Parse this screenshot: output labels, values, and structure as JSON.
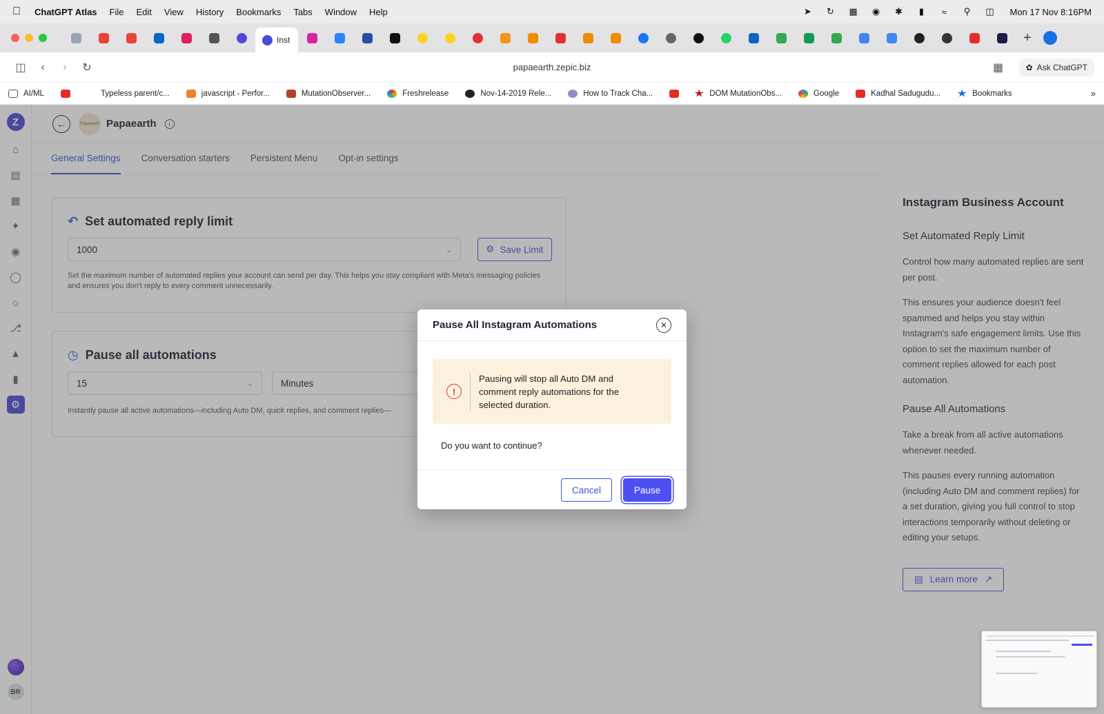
{
  "menubar": {
    "app_name": "ChatGPT Atlas",
    "menus": [
      "File",
      "Edit",
      "View",
      "History",
      "Bookmarks",
      "Tabs",
      "Window",
      "Help"
    ],
    "clock": "Mon 17 Nov  8:16PM"
  },
  "browser": {
    "active_tab_label": "Inst",
    "url": "papaearth.zepic.biz",
    "ask_button": "Ask ChatGPT",
    "bookmarks": [
      {
        "label": "AI/ML",
        "color": "#555555"
      },
      {
        "label": "",
        "color": "#e52d27"
      },
      {
        "label": "Typeless parent/c...",
        "color": "#ffffff"
      },
      {
        "label": "javascript - Perfor...",
        "color": "#f48024"
      },
      {
        "label": "MutationObserver...",
        "color": "#b5412e"
      },
      {
        "label": "Freshrelease",
        "color": "#3fa7e8"
      },
      {
        "label": "Nov-14-2019 Rele...",
        "color": "#222222"
      },
      {
        "label": "How to Track Cha...",
        "color": "#8f8fc8"
      },
      {
        "label": "",
        "color": "#e52d27"
      },
      {
        "label": "DOM MutationObs...",
        "color": "#b22222"
      },
      {
        "label": "Google",
        "color": "#4285f4"
      },
      {
        "label": "Kadhal Sadugudu...",
        "color": "#e52d27"
      },
      {
        "label": "Bookmarks",
        "color": "#1a6ee8"
      }
    ]
  },
  "app": {
    "brand_name": "Papaearth",
    "brand_avatar_text": "Papaearth",
    "tabs": [
      "General Settings",
      "Conversation starters",
      "Persistent Menu",
      "Opt-in settings"
    ],
    "reply_limit": {
      "title": "Set automated reply limit",
      "value": "1000",
      "save_label": "Save Limit",
      "help": "Set the maximum number of automated replies your account can send per day. This helps you stay compliant with Meta's messaging policies and ensures you don't reply to every comment unnecessarily."
    },
    "pause": {
      "title": "Pause all automations",
      "duration_value": "15",
      "unit_value": "Minutes",
      "help": "Instantly pause all active automations—including Auto DM, quick replies, and comment replies—"
    },
    "user_initials": "BR"
  },
  "right_panel": {
    "title": "Instagram Business Account",
    "section1_title": "Set Automated Reply Limit",
    "section1_p1": "Control how many automated replies are sent per post.",
    "section1_p2": "This ensures your audience doesn't feel spammed and helps you stay within Instagram's safe engagement limits. Use this option to set the maximum number of comment replies allowed for each post automation.",
    "section2_title": "Pause All Automations",
    "section2_p1": "Take a break from all active automations whenever needed.",
    "section2_p2": "This pauses every running automation (including Auto DM and comment replies) for a set duration, giving you full control to stop interactions temporarily without deleting or editing your setups.",
    "learn_more": "Learn more"
  },
  "modal": {
    "title": "Pause All Instagram Automations",
    "warning": "Pausing will stop all Auto DM and comment reply automations for the selected duration.",
    "question": "Do you want to continue?",
    "cancel_label": "Cancel",
    "pause_label": "Pause"
  },
  "colors": {
    "accent": "#3b5bdb",
    "primary_button": "#4c4ff2",
    "warning_bg": "#fcf1dc",
    "warning_icon": "#e03131"
  }
}
